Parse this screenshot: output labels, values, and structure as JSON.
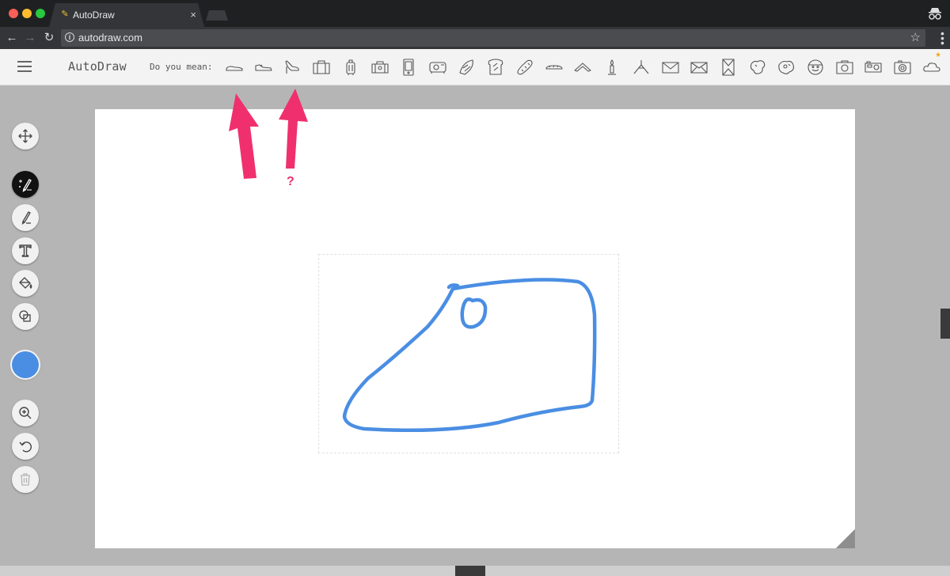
{
  "browser": {
    "tab_title": "AutoDraw",
    "tab_close": "×",
    "url": "autodraw.com",
    "info_glyph": "i",
    "favicon_glyph": "✎"
  },
  "app": {
    "title": "AutoDraw",
    "suggest_label": "Do you mean:",
    "suggestions": [
      "shoe-flat",
      "sneaker",
      "high-heel",
      "briefcase",
      "suitcase",
      "luggage",
      "phone",
      "camera-van",
      "tropical-fish",
      "toast",
      "bread",
      "baguette",
      "boomerang",
      "candle",
      "hanger",
      "envelope",
      "envelope-2",
      "box",
      "map",
      "world-map",
      "face",
      "camera",
      "camera-2",
      "camera-3",
      "cloud"
    ]
  },
  "tools": [
    {
      "name": "move-tool",
      "icon": "move-icon"
    },
    {
      "name": "autodraw-tool",
      "icon": "autodraw-icon",
      "active": true
    },
    {
      "name": "draw-tool",
      "icon": "pencil-icon"
    },
    {
      "name": "type-tool",
      "icon": "text-icon"
    },
    {
      "name": "fill-tool",
      "icon": "paint-bucket-icon"
    },
    {
      "name": "shape-tool",
      "icon": "shapes-icon"
    },
    {
      "name": "zoom-tool",
      "icon": "zoom-icon"
    },
    {
      "name": "undo-tool",
      "icon": "undo-icon"
    },
    {
      "name": "delete-tool",
      "icon": "trash-icon",
      "disabled": true
    }
  ],
  "colors": {
    "stroke": "#4a8ee3",
    "current_color": "#4a8ee3",
    "arrow": "#f0306e",
    "active_tool": "#111111"
  },
  "annotation": {
    "question_mark": "?"
  }
}
